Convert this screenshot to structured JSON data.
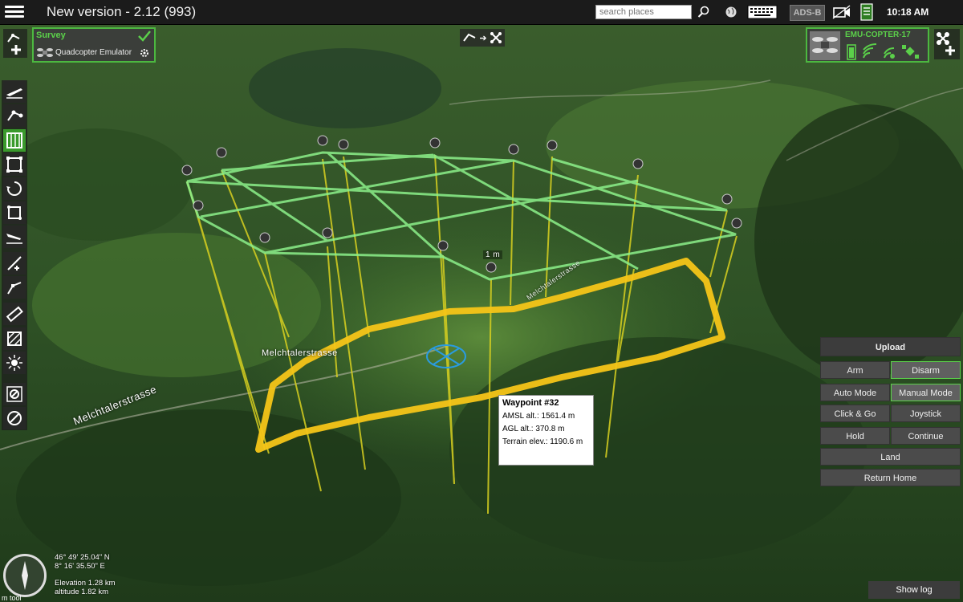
{
  "header": {
    "title": "New version - 2.12 (993)",
    "search_placeholder": "search places",
    "adsb_label": "ADS-B",
    "clock": "10:18 AM"
  },
  "mission": {
    "plan_title": "Survey",
    "vehicle_type": "Quadcopter Emulator"
  },
  "vehicle": {
    "name": "EMU-COPTER-17"
  },
  "map": {
    "road_label_1": "Melchtalerstrasse",
    "road_label_2": "Melchtalerstrasse",
    "road_label_3": "Melchtalerstrasse",
    "scale_label": "1 m"
  },
  "waypoint_tooltip": {
    "title": "Waypoint #32",
    "amsl": "AMSL alt.: 1561.4 m",
    "agl": "AGL alt.: 370.8 m",
    "terrain": "Terrain elev.: 1190.6 m"
  },
  "commands": {
    "upload": "Upload",
    "arm": "Arm",
    "disarm": "Disarm",
    "auto_mode": "Auto Mode",
    "manual_mode": "Manual Mode",
    "click_go": "Click & Go",
    "joystick": "Joystick",
    "hold": "Hold",
    "continue": "Continue",
    "land": "Land",
    "return_home": "Return Home"
  },
  "status": {
    "lat": "46° 49' 25.04\" N",
    "lon": "8° 16' 35.50\" E",
    "elevation": "Elevation 1.28 km",
    "eye_altitude": "altitude 1.82 km",
    "compass_label": "N",
    "bottom_left_fragment": "m tool"
  },
  "footer": {
    "show_log": "Show log"
  },
  "colors": {
    "accent_green": "#4cb840",
    "grid_line": "#8cf08a",
    "flight_path": "#f5c518",
    "pole": "#d8d020"
  },
  "icons": {
    "add_plan": "add-plan-icon",
    "menu": "hamburger-icon",
    "search": "search-icon",
    "globe": "globe-icon",
    "keyboard": "keyboard-icon",
    "video": "video-icon",
    "checklist": "checklist-icon"
  }
}
